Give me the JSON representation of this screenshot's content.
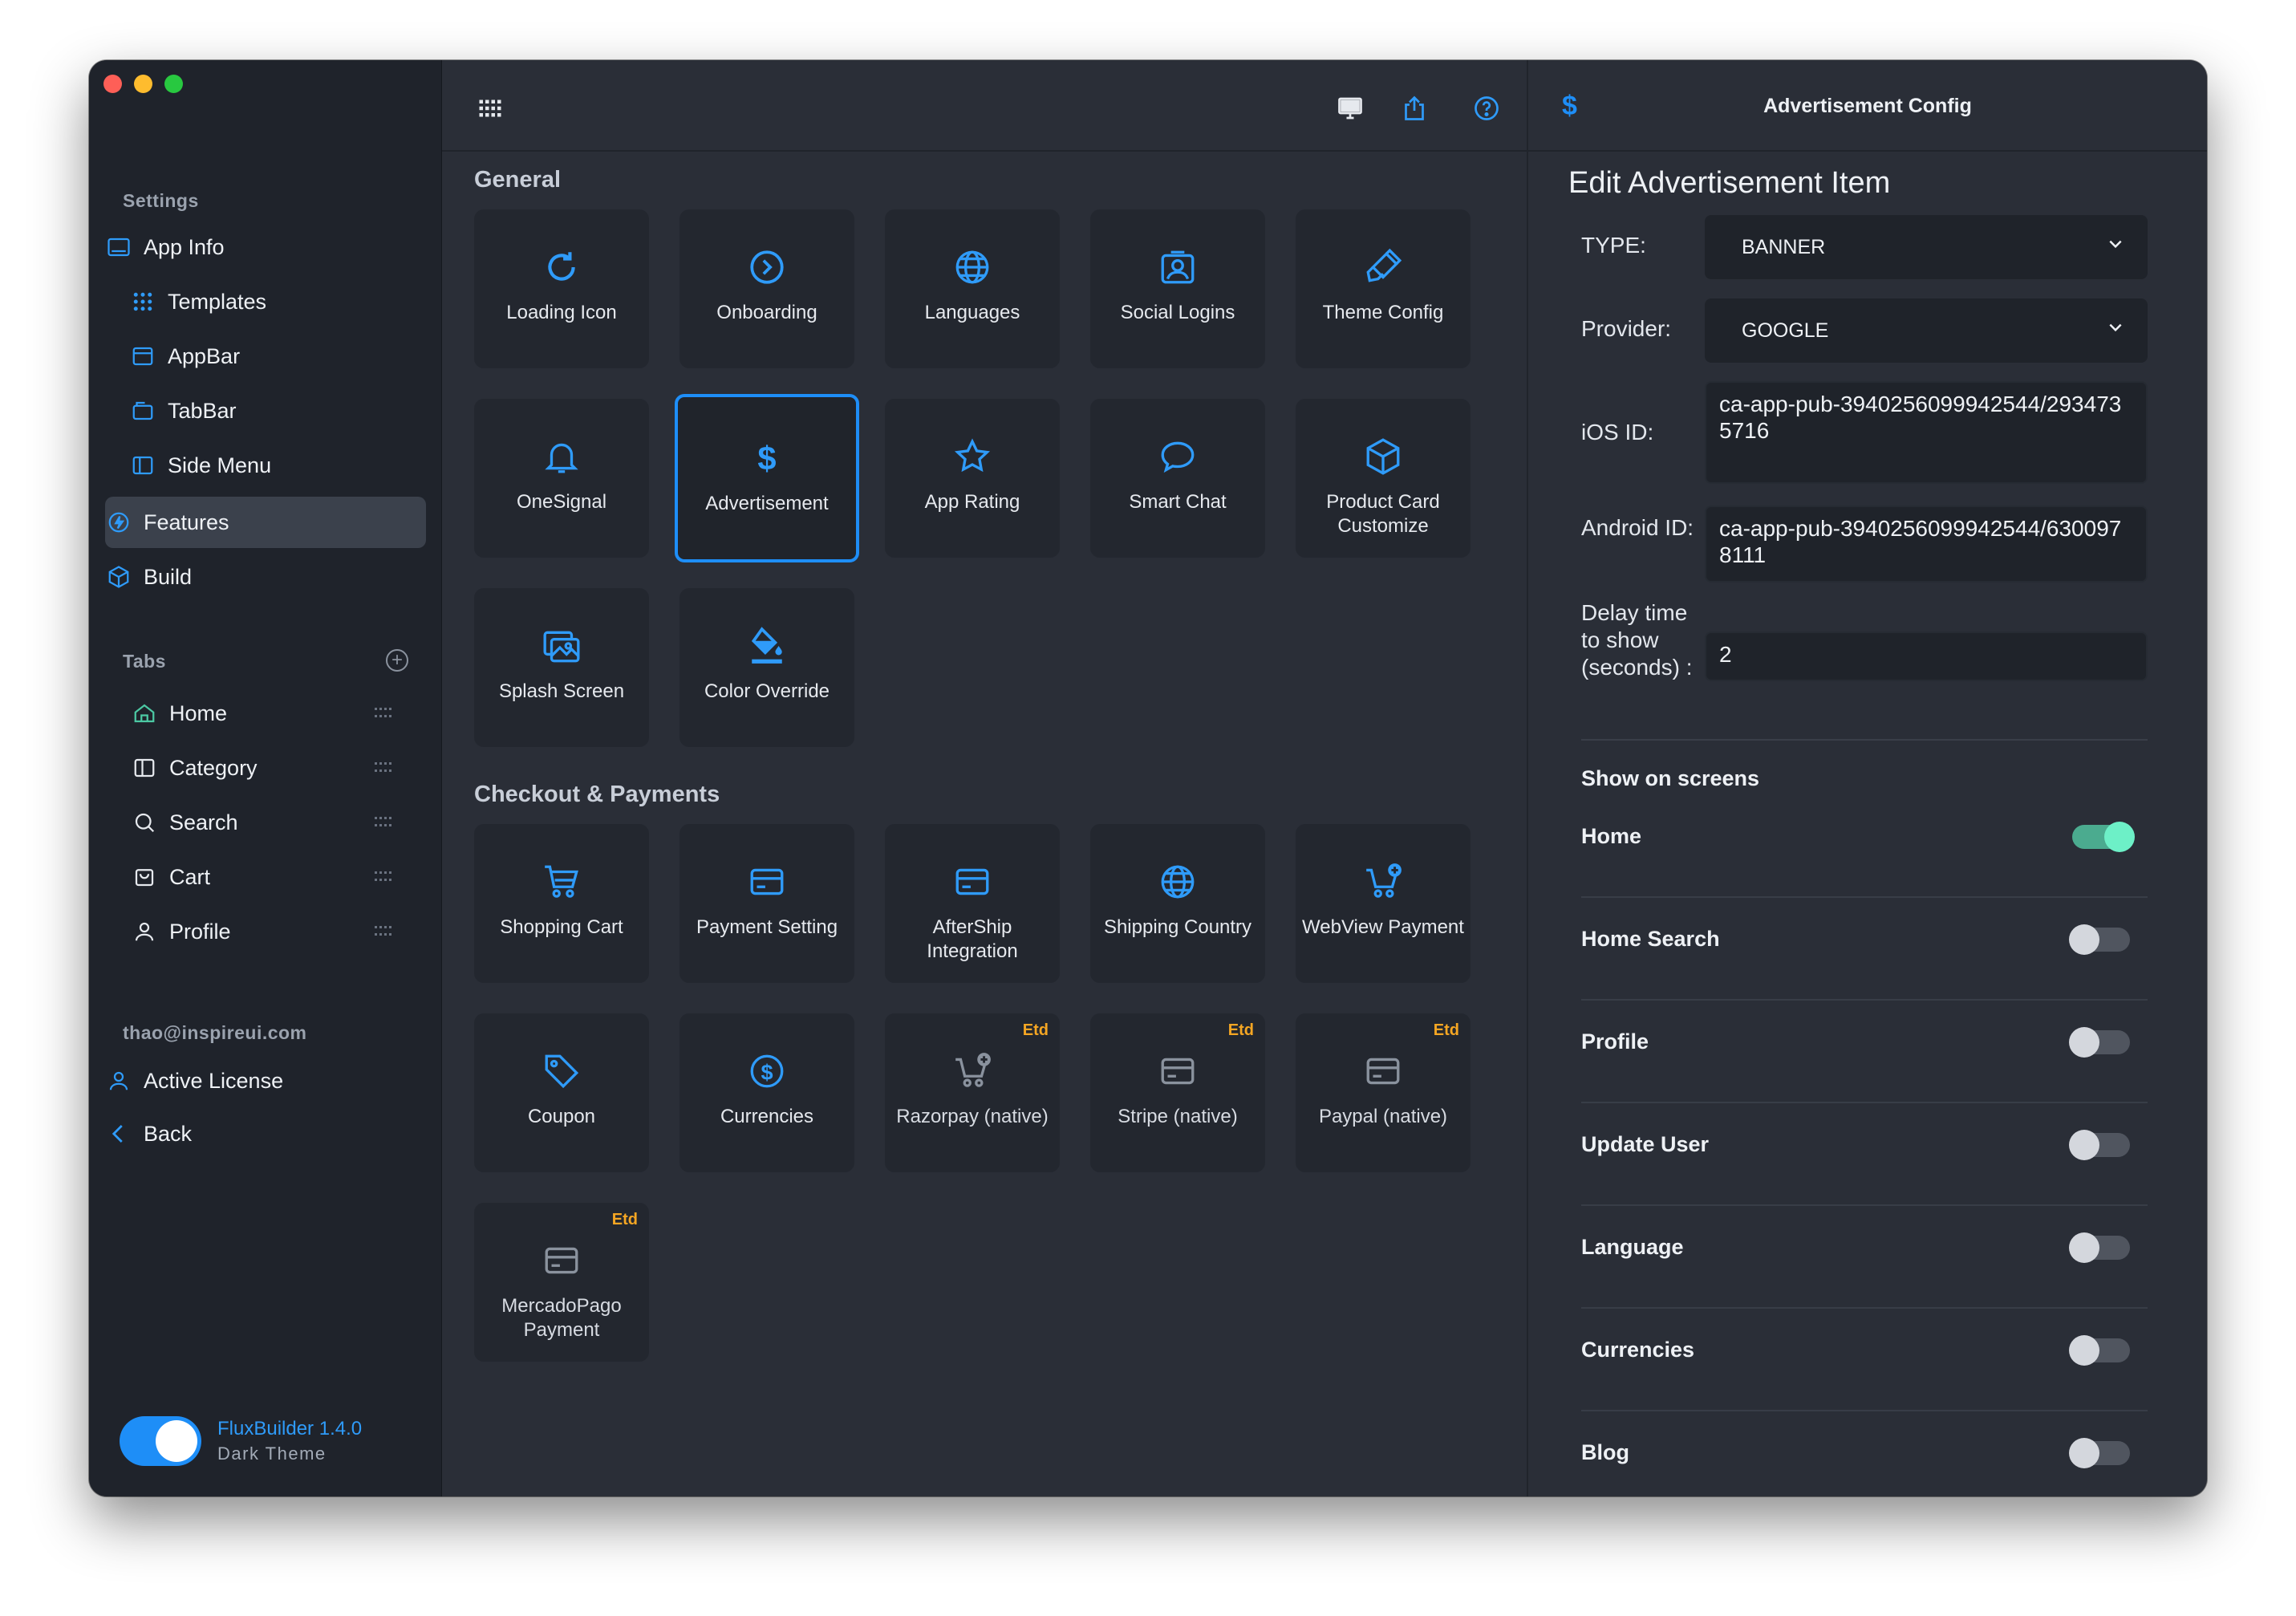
{
  "sidebar": {
    "settings_label": "Settings",
    "settings_items": [
      {
        "label": "App Info",
        "icon": "app-info-icon"
      },
      {
        "label": "Templates",
        "icon": "templates-icon"
      },
      {
        "label": "AppBar",
        "icon": "appbar-icon"
      },
      {
        "label": "TabBar",
        "icon": "tabbar-icon"
      },
      {
        "label": "Side Menu",
        "icon": "side-menu-icon"
      },
      {
        "label": "Features",
        "icon": "features-icon",
        "active": true
      },
      {
        "label": "Build",
        "icon": "build-icon"
      }
    ],
    "tabs_label": "Tabs",
    "tabs": [
      {
        "label": "Home",
        "icon": "home-icon"
      },
      {
        "label": "Category",
        "icon": "category-icon"
      },
      {
        "label": "Search",
        "icon": "search-icon"
      },
      {
        "label": "Cart",
        "icon": "cart-icon"
      },
      {
        "label": "Profile",
        "icon": "profile-icon"
      }
    ],
    "account_email": "thao@inspireui.com",
    "account_items": [
      {
        "label": "Active License",
        "icon": "license-icon"
      },
      {
        "label": "Back",
        "icon": "back-icon"
      }
    ],
    "brand": "FluxBuilder 1.4.0",
    "theme_label": "Dark Theme",
    "theme_dark": true
  },
  "main": {
    "groups": [
      {
        "title": "General",
        "items": [
          {
            "label": "Loading Icon",
            "icon": "reload-icon"
          },
          {
            "label": "Onboarding",
            "icon": "onboarding-icon"
          },
          {
            "label": "Languages",
            "icon": "globe-icon"
          },
          {
            "label": "Social Logins",
            "icon": "social-login-icon"
          },
          {
            "label": "Theme Config",
            "icon": "brush-icon"
          },
          {
            "label": "OneSignal",
            "icon": "bell-icon"
          },
          {
            "label": "Advertisement",
            "icon": "dollar-icon",
            "selected": true
          },
          {
            "label": "App Rating",
            "icon": "star-icon"
          },
          {
            "label": "Smart Chat",
            "icon": "chat-icon"
          },
          {
            "label": "Product Card Customize",
            "icon": "box-icon"
          },
          {
            "label": "Splash Screen",
            "icon": "images-icon"
          },
          {
            "label": "Color Override",
            "icon": "paint-bucket-icon"
          }
        ]
      },
      {
        "title": "Checkout & Payments",
        "items": [
          {
            "label": "Shopping Cart",
            "icon": "cart-icon"
          },
          {
            "label": "Payment Setting",
            "icon": "credit-card-icon"
          },
          {
            "label": "AfterShip Integration",
            "icon": "credit-card-icon"
          },
          {
            "label": "Shipping Country",
            "icon": "globe-icon"
          },
          {
            "label": "WebView Payment",
            "icon": "cart-plus-icon"
          },
          {
            "label": "Coupon",
            "icon": "tag-icon"
          },
          {
            "label": "Currencies",
            "icon": "dollar-circle-icon"
          },
          {
            "label": "Razorpay (native)",
            "icon": "cart-plus-icon",
            "badge": "Etd",
            "dim": true
          },
          {
            "label": "Stripe (native)",
            "icon": "credit-card-icon",
            "badge": "Etd",
            "dim": true
          },
          {
            "label": "Paypal (native)",
            "icon": "credit-card-icon",
            "badge": "Etd",
            "dim": true
          },
          {
            "label": "MercadoPago Payment",
            "icon": "credit-card-icon",
            "badge": "Etd",
            "dim": true
          }
        ]
      }
    ]
  },
  "panel": {
    "header_icon": "dollar-icon",
    "title": "Advertisement Config",
    "edit_title": "Edit Advertisement Item",
    "type_label": "TYPE:",
    "type_value": "BANNER",
    "provider_label": "Provider:",
    "provider_value": "GOOGLE",
    "ios_label": "iOS ID:",
    "ios_value": "ca-app-pub-3940256099942544/2934735716",
    "android_label": "Android ID:",
    "android_value": "ca-app-pub-3940256099942544/6300978111",
    "delay_label": "Delay time to show (seconds) :",
    "delay_value": "2",
    "show_title": "Show on screens",
    "screens": [
      {
        "label": "Home",
        "on": true
      },
      {
        "label": "Home Search",
        "on": false
      },
      {
        "label": "Profile",
        "on": false
      },
      {
        "label": "Update User",
        "on": false
      },
      {
        "label": "Language",
        "on": false
      },
      {
        "label": "Currencies",
        "on": false
      },
      {
        "label": "Blog",
        "on": false
      }
    ]
  },
  "colors": {
    "accent": "#1e8ef7",
    "badge": "#f5a623",
    "toggle_on": "#6df0c7"
  }
}
